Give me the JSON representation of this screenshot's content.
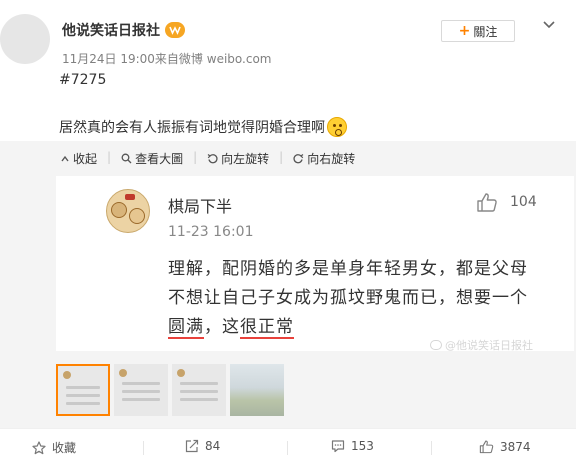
{
  "post": {
    "author": "他说笑话日报社",
    "meta": "11月24日 19:00来自微博 weibo.com",
    "follow_label": "關注",
    "tag": "#7275",
    "text": "居然真的会有人振振有词地觉得阴婚合理啊"
  },
  "media_toolbar": {
    "collapse": "收起",
    "view_large": "查看大圖",
    "rotate_left": "向左旋转",
    "rotate_right": "向右旋转"
  },
  "comment_card": {
    "name": "棋局下半",
    "date": "11-23 16:01",
    "likes": "104",
    "line1": "理解，配阴婚的多是单身年轻男女，都是父母",
    "line2": "不想让自己子女成为孤坟野鬼而已，想要一个",
    "line3_a": "圆满",
    "line3_b": "，这",
    "line3_c": "很正常"
  },
  "watermark": "@他说笑话日报社",
  "actions": {
    "favorite": "收藏",
    "repost": "84",
    "comment": "153",
    "like": "3874"
  },
  "colors": {
    "accent": "#ff8200",
    "underline": "#e8413b"
  }
}
